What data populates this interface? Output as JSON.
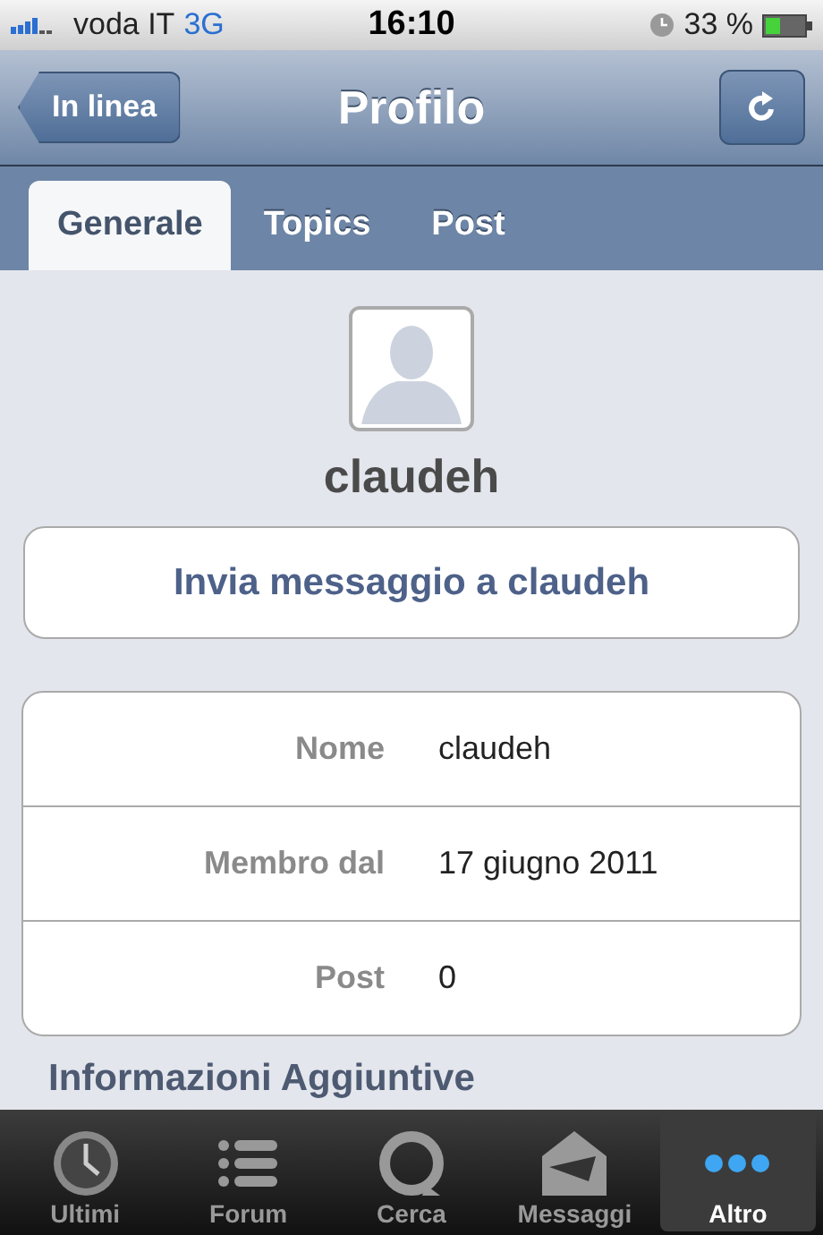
{
  "status_bar": {
    "carrier": "voda IT",
    "network": "3G",
    "time": "16:10",
    "battery": "33 %"
  },
  "nav_bar": {
    "back": "In linea",
    "title": "Profilo"
  },
  "tabs": [
    {
      "label": "Generale",
      "selected": true
    },
    {
      "label": "Topics",
      "selected": false
    },
    {
      "label": "Post",
      "selected": false
    }
  ],
  "profile": {
    "username": "claudeh",
    "message_button": "Invia messaggio a claudeh"
  },
  "details": [
    {
      "label": "Nome",
      "value": "claudeh"
    },
    {
      "label": "Membro dal",
      "value": "17 giugno 2011"
    },
    {
      "label": "Post",
      "value": "0"
    }
  ],
  "section_header": "Informazioni Aggiuntive",
  "tab_bar": [
    {
      "label": "Ultimi",
      "kind": "clock",
      "selected": false
    },
    {
      "label": "Forum",
      "kind": "list",
      "selected": false
    },
    {
      "label": "Cerca",
      "kind": "search",
      "selected": false
    },
    {
      "label": "Messaggi",
      "kind": "mail",
      "selected": false
    },
    {
      "label": "Altro",
      "kind": "more",
      "selected": true
    }
  ]
}
